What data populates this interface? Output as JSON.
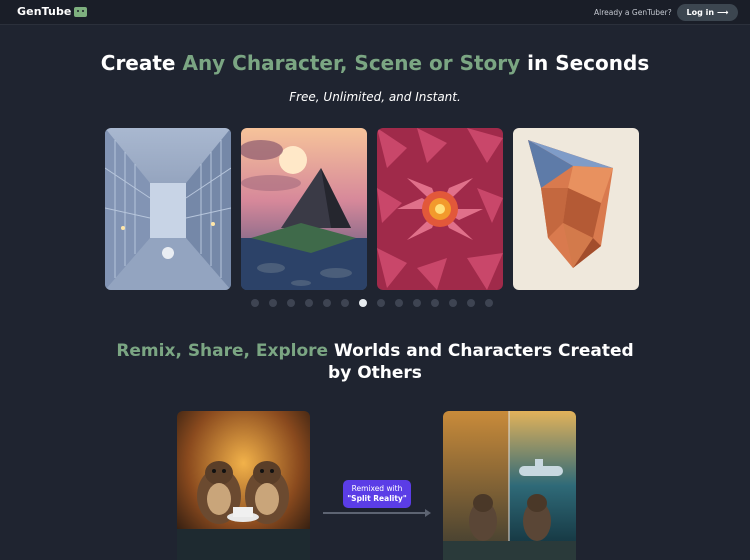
{
  "header": {
    "brand": "GenTube",
    "already_text": "Already a GenTuber?",
    "login_label": "Log in",
    "login_arrow": "⟶"
  },
  "hero": {
    "title_accent": "Create ",
    "title_accent2": "Any Character, Scene or Story",
    "title_rest": " in Seconds",
    "subtitle": "Free, Unlimited, and Instant."
  },
  "carousel": {
    "cards": [
      {
        "name": "futuristic-corridor-image"
      },
      {
        "name": "floating-island-sunset-image"
      },
      {
        "name": "pink-geometric-flower-image"
      },
      {
        "name": "low-poly-face-sculpture-image"
      }
    ],
    "dot_count": 14,
    "active_dot": 6
  },
  "section": {
    "title_accent": "Remix, Share, Explore",
    "title_rest": " Worlds and Characters Created",
    "title_line2": "by Others"
  },
  "remix": {
    "badge_line1": "Remixed with",
    "badge_line2": "\"Split Reality\"",
    "colors": {
      "badge": "#5b3de6",
      "accent": "#7ba683"
    }
  }
}
